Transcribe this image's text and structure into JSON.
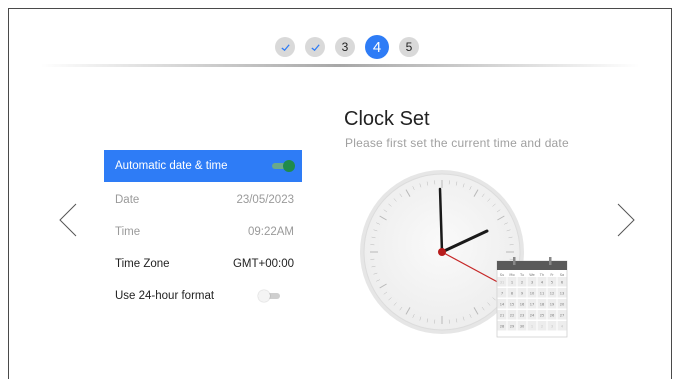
{
  "steps": [
    {
      "state": "done",
      "icon": "check-icon"
    },
    {
      "state": "done",
      "icon": "check-icon"
    },
    {
      "state": "pending",
      "label": "3"
    },
    {
      "state": "active",
      "label": "4"
    },
    {
      "state": "pending",
      "label": "5"
    }
  ],
  "page": {
    "title": "Clock Set",
    "subtitle": "Please first set the current time and date"
  },
  "settings": {
    "auto_label": "Automatic date & time",
    "auto_on": true,
    "date_label": "Date",
    "date_value": "23/05/2023",
    "time_label": "Time",
    "time_value": "09:22AM",
    "timezone_label": "Time Zone",
    "timezone_value": "GMT+00:00",
    "format_label": "Use 24-hour format",
    "format_on": false
  },
  "calendar": {
    "weekday_header": [
      "Su",
      "Mo",
      "Tu",
      "We",
      "Th",
      "Fr",
      "Sa"
    ],
    "rows": [
      [
        "31",
        "1",
        "2",
        "3",
        "4",
        "5",
        "6"
      ],
      [
        "7",
        "8",
        "9",
        "10",
        "11",
        "12",
        "13"
      ],
      [
        "14",
        "15",
        "16",
        "17",
        "18",
        "19",
        "20"
      ],
      [
        "21",
        "22",
        "23",
        "24",
        "25",
        "26",
        "27"
      ],
      [
        "28",
        "29",
        "30",
        "1",
        "2",
        "3",
        "4"
      ]
    ]
  },
  "colors": {
    "accent": "#2e7cf6",
    "toggle_on": "#1f8b4c",
    "second_hand": "#c62828"
  },
  "icons": {
    "prev": "chevron-left-icon",
    "next": "chevron-right-icon"
  }
}
